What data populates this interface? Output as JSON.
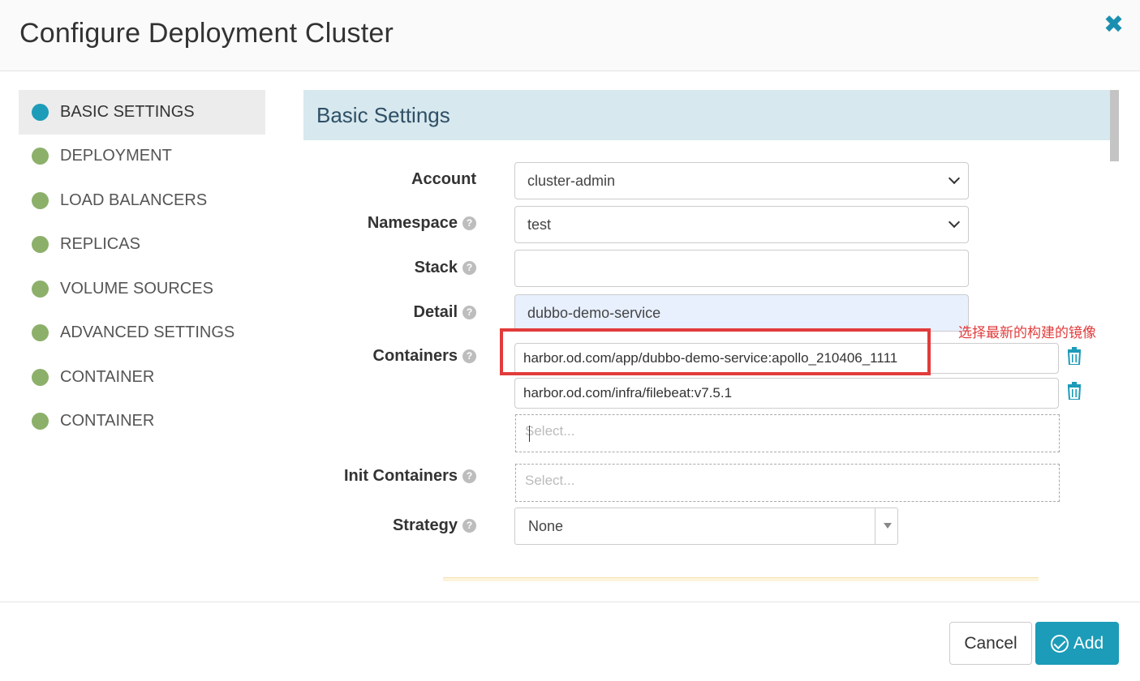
{
  "modal": {
    "title": "Configure Deployment Cluster",
    "close_icon": "close-icon"
  },
  "sidebar": {
    "items": [
      {
        "label": "BASIC SETTINGS",
        "active": true
      },
      {
        "label": "DEPLOYMENT",
        "active": false
      },
      {
        "label": "LOAD BALANCERS",
        "active": false
      },
      {
        "label": "REPLICAS",
        "active": false
      },
      {
        "label": "VOLUME SOURCES",
        "active": false
      },
      {
        "label": "ADVANCED SETTINGS",
        "active": false
      },
      {
        "label": "CONTAINER",
        "active": false
      },
      {
        "label": "CONTAINER",
        "active": false
      }
    ]
  },
  "section": {
    "title": "Basic Settings"
  },
  "form": {
    "account": {
      "label": "Account",
      "value": "cluster-admin"
    },
    "namespace": {
      "label": "Namespace",
      "value": "test"
    },
    "stack": {
      "label": "Stack",
      "value": ""
    },
    "detail": {
      "label": "Detail",
      "value": "dubbo-demo-service"
    },
    "containers": {
      "label": "Containers",
      "items": [
        "harbor.od.com/app/dubbo-demo-service:apollo_210406_1111",
        "harbor.od.com/infra/filebeat:v7.5.1"
      ],
      "placeholder": "Select..."
    },
    "init_containers": {
      "label": "Init Containers",
      "placeholder": "Select..."
    },
    "strategy": {
      "label": "Strategy",
      "value": "None"
    }
  },
  "annotation": {
    "text": "选择最新的构建的镜像",
    "color": "#e23b3b"
  },
  "footer": {
    "cancel_label": "Cancel",
    "add_label": "Add"
  },
  "colors": {
    "accent": "#1c9cb8",
    "nav_dot": "#8cb06a",
    "section_bg": "#d7e8ee"
  }
}
